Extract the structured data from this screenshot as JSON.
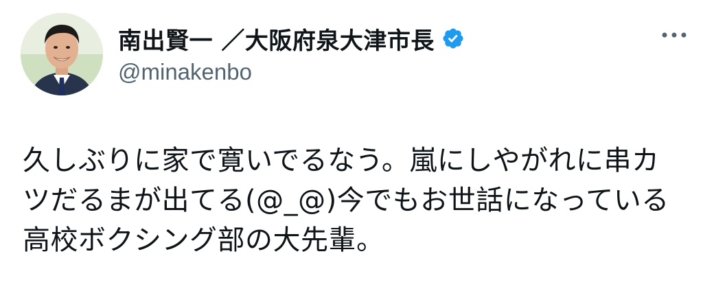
{
  "author": {
    "display_name": "南出賢一 ／大阪府泉大津市長",
    "handle": "@minakenbo",
    "avatar_icon": "user-avatar-photo",
    "verified_icon": "verified-badge-icon",
    "verified_color": "#1d9bf0"
  },
  "menu": {
    "more_icon": "more-options-icon"
  },
  "tweet": {
    "text": "久しぶりに家で寛いでるなう。嵐にしやがれに串カツだるまが出てる(@_@)今でもお世話になっている高校ボクシング部の大先輩。"
  },
  "colors": {
    "text": "#0f1419",
    "secondary": "#536471",
    "accent": "#1d9bf0"
  }
}
